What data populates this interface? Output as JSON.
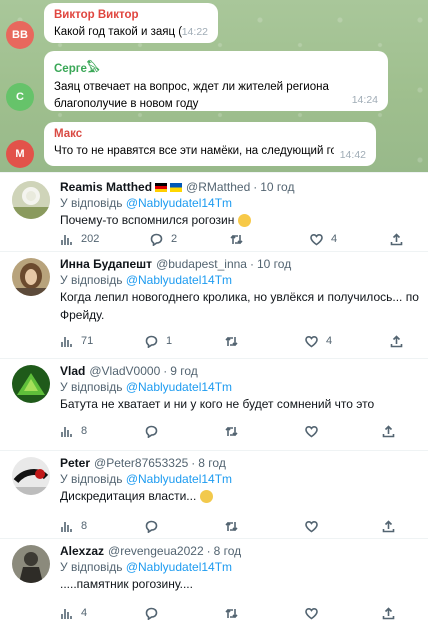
{
  "telegram": {
    "messages": [
      {
        "initials": "ВВ",
        "name": "Виктор Виктор",
        "name_color": "#e0463f",
        "avatar_color": "#e8685d",
        "text": "Какой год такой и заяц (",
        "time": "14:22"
      },
      {
        "initials": "С",
        "name": "Серге⁠𓅃",
        "name_color": "#3aa757",
        "avatar_color": "#66c36a",
        "text_line1": "Заяц отвечает на вопрос, ждет ли жителей региона",
        "text_line2": "благополучие в новом году",
        "time": "14:24"
      },
      {
        "initials": "М",
        "name": "Макс",
        "name_color": "#d94a43",
        "avatar_color": "#e2524a",
        "text": "Что то не нравятся все эти намёки, на следующий год...",
        "time": "14:42"
      }
    ]
  },
  "tweets": [
    {
      "name": "Reamis Matthed",
      "handle": "@RMatthed",
      "time": "10 год",
      "reply_prefix": "У відповідь",
      "mention": "@Nablyudatel14Tm",
      "text": "Почему-то вспомнился рогозин",
      "views": "202",
      "replies": "2",
      "retweets": "",
      "likes": "4"
    },
    {
      "name": "Инна Будапешт",
      "handle": "@budapest_inna",
      "time": "10 год",
      "reply_prefix": "У відповідь",
      "mention": "@Nablyudatel14Tm",
      "text_line1": "Когда лепил новогоднего кролика, но увлёкся и получилось... по",
      "text_line2": "Фрейду.",
      "views": "71",
      "replies": "1",
      "retweets": "",
      "likes": "4"
    },
    {
      "name": "Vlad",
      "handle": "@VladV0000",
      "time": "9 год",
      "reply_prefix": "У відповідь",
      "mention": "@Nablyudatel14Tm",
      "text": "Батута не хватает и ни у кого не будет сомнений что это",
      "views": "8",
      "replies": "",
      "retweets": "",
      "likes": ""
    },
    {
      "name": "Peter",
      "handle": "@Peter87653325",
      "time": "8 год",
      "reply_prefix": "У відповідь",
      "mention": "@Nablyudatel14Tm",
      "text": "Дискредитация власти...",
      "views": "8",
      "replies": "",
      "retweets": "",
      "likes": ""
    },
    {
      "name": "Alexzaz",
      "handle": "@revengeua2022",
      "time": "8 год",
      "reply_prefix": "У відповідь",
      "mention": "@Nablyudatel14Tm",
      "text": ".....памятник  рогозину....",
      "views": "4",
      "replies": "",
      "retweets": "",
      "likes": ""
    }
  ],
  "icons": {
    "views": "bar-chart-icon",
    "reply": "speech-bubble-icon",
    "retweet": "retweet-icon",
    "like": "heart-icon",
    "share": "share-icon"
  },
  "colors": {
    "mention": "#1d9bf0",
    "muted": "#536471",
    "telegram_bg": "#a3c393"
  }
}
